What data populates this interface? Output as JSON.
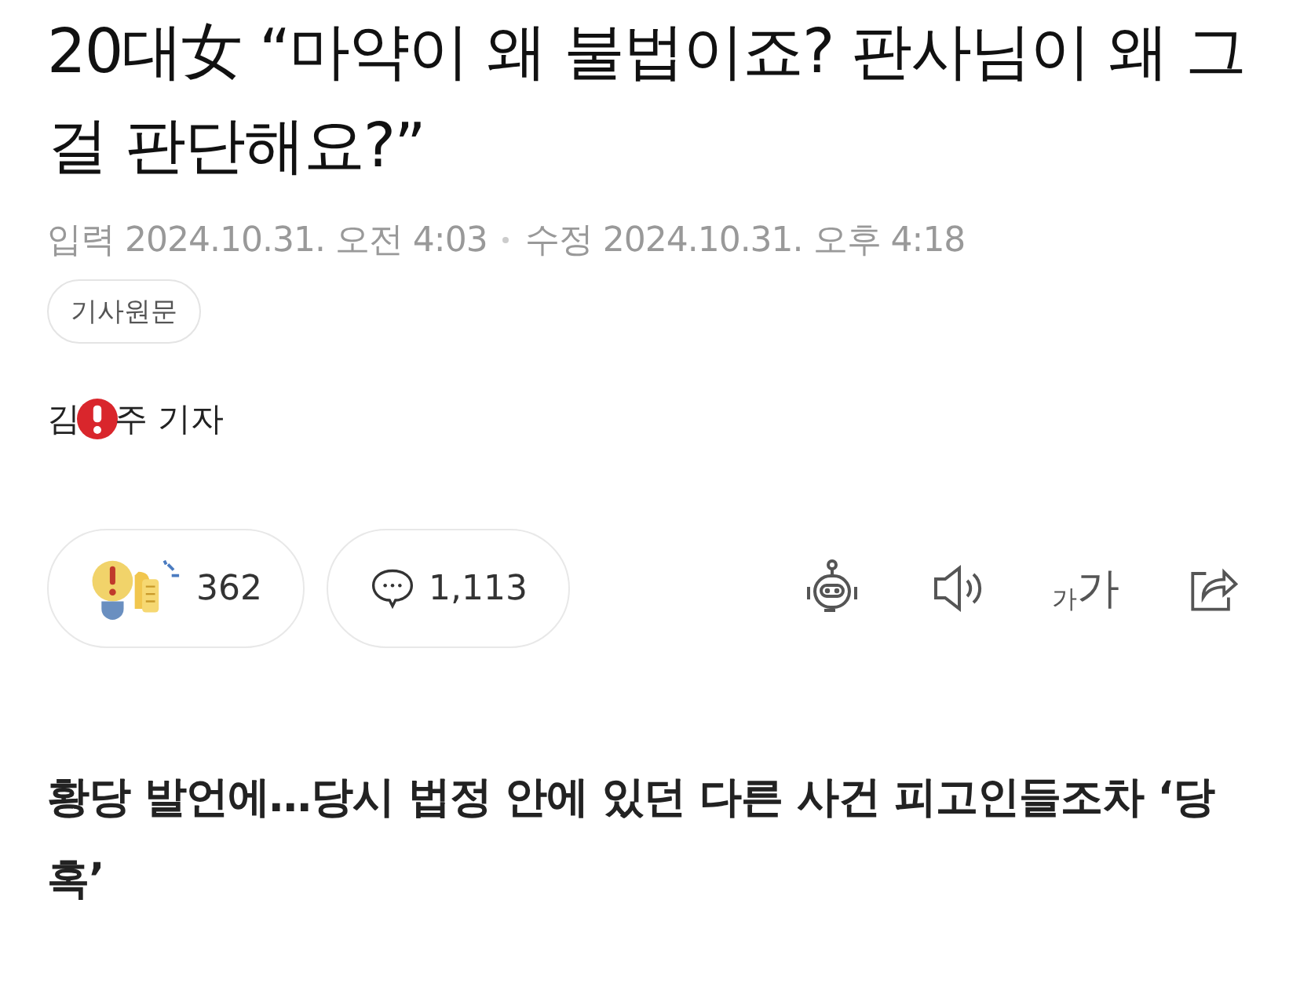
{
  "article": {
    "title": "20대女 “마약이 왜 불법이죠? 판사님이 왜 그걸 판단해요?”",
    "meta": [
      {
        "label": "입력",
        "value": "2024.10.31. 오전 4:03"
      },
      {
        "label": "수정",
        "value": "2024.10.31. 오후 4:18"
      }
    ],
    "original_link": "기사원문",
    "reporter": {
      "before": "김",
      "after": "주 기자"
    },
    "reactions": {
      "count": "362"
    },
    "comments": {
      "count": "1,113"
    },
    "font_size": {
      "small": "가",
      "large": "가"
    },
    "subtitle": "황당 발언에…당시 법정 안에 있던 다른 사건 피고인들조차 ‘당혹’"
  }
}
